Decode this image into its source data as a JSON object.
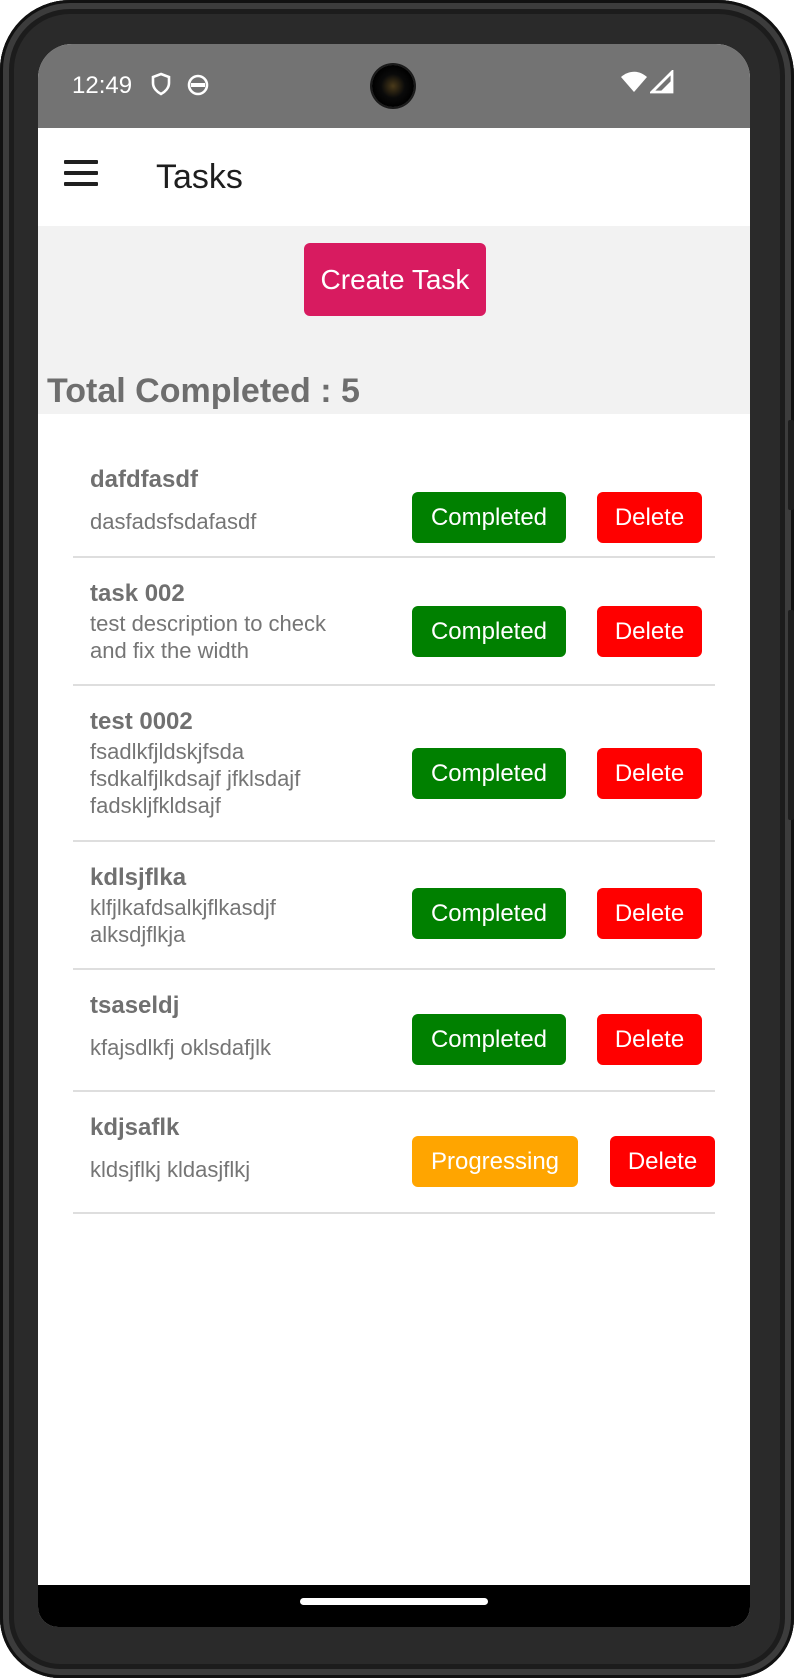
{
  "status_bar": {
    "time": "12:49",
    "icons": [
      "shield-icon",
      "android-robot-icon",
      "wifi-icon",
      "signal-icon"
    ]
  },
  "app_bar": {
    "title": "Tasks",
    "menu_icon": "hamburger-menu-icon"
  },
  "header": {
    "create_button_label": "Create Task",
    "total_completed": "Total Completed : 5"
  },
  "colors": {
    "status_bar": "#737373",
    "create_button": "#d81b60",
    "completed": "#008000",
    "progressing": "#ffa500",
    "delete": "#ff0000",
    "header_bg": "#f2f2f2"
  },
  "tasks": [
    {
      "title": "dafdfasdf",
      "description": "dasfadsfsdafasdf",
      "status": "Completed",
      "delete_label": "Delete"
    },
    {
      "title": "task 002",
      "description": "test description to check and fix the width",
      "status": "Completed",
      "delete_label": "Delete"
    },
    {
      "title": "test 0002",
      "description": "fsadlkfjldskjfsda fsdkalfjlkdsajf jfklsdajf fadskljfkldsajf",
      "status": "Completed",
      "delete_label": "Delete"
    },
    {
      "title": "kdlsjflka",
      "description": "klfjlkafdsalkjflkasdjf alksdjflkja",
      "status": "Completed",
      "delete_label": "Delete"
    },
    {
      "title": "tsaseldj",
      "description": "kfajsdlkfj oklsdafjlk",
      "status": "Completed",
      "delete_label": "Delete"
    },
    {
      "title": "kdjsaflk",
      "description": "kldsjflkj kldasjflkj",
      "status": "Progressing",
      "delete_label": "Delete"
    }
  ]
}
